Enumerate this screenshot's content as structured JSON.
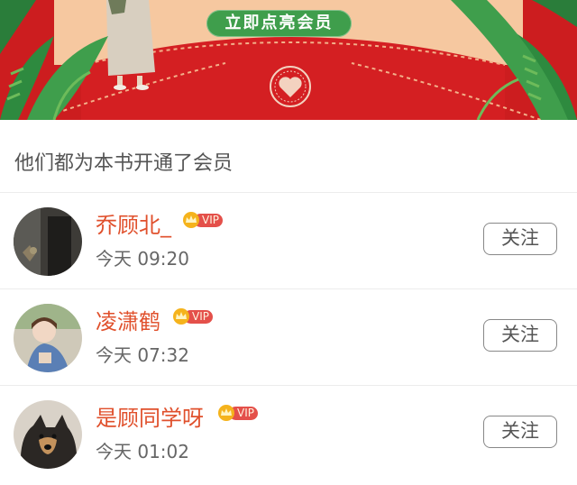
{
  "banner": {
    "cta_label": "立即点亮会员"
  },
  "section": {
    "title": "他们都为本书开通了会员"
  },
  "vip_label": "VIP",
  "follow_label": "关注",
  "members": [
    {
      "name": "乔顾北_",
      "time": "今天 09:20"
    },
    {
      "name": "凌潇鹤",
      "time": "今天 07:32"
    },
    {
      "name": "是顾同学呀",
      "time": "今天 01:02"
    }
  ],
  "colors": {
    "banner_red": "#cc1d1f",
    "cta_green": "#3f9e4c",
    "name_orange": "#e0502c",
    "vip_red": "#e4504a"
  }
}
